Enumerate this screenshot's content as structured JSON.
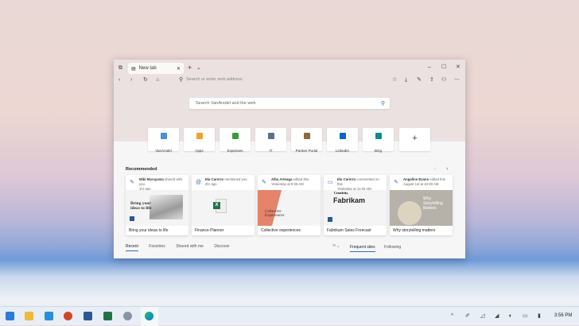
{
  "browser": {
    "tab_title": "New tab",
    "address_placeholder": "Search or enter web address",
    "search_placeholder": "Search VanArsdel and the web"
  },
  "quick_links": [
    {
      "label": "VanArsdel",
      "color": "#4a90d9"
    },
    {
      "label": "Apps",
      "color": "#f0a030"
    },
    {
      "label": "Expenses",
      "color": "#3a9a3a"
    },
    {
      "label": "IT",
      "color": "#5a7090"
    },
    {
      "label": "Partner Portal",
      "color": "#8a6a40"
    },
    {
      "label": "LinkedIn",
      "color": "#0a66c2"
    },
    {
      "label": "Bing",
      "color": "#0a8a8a"
    }
  ],
  "recommended": {
    "heading": "Recommended",
    "cards": [
      {
        "who": "Miki Maruyama",
        "action": "shared with you",
        "when": "1hr ago",
        "title": "Bring your ideas to life",
        "preview": "Bring your ideas to life"
      },
      {
        "who": "Ela Carerro",
        "action": "mentioned you",
        "when": "2hr ago",
        "title": "Finance Planner",
        "preview": "X"
      },
      {
        "who": "Alba Arteaga",
        "action": "edited this",
        "when": "Yesterday at 9:35 AM",
        "title": "Collective experiences",
        "preview": "Collective Experiences"
      },
      {
        "who": "Ela Carerro",
        "action": "commented on this",
        "when": "Yesterday at 11:03 AM",
        "title": "Fabrikam Sales Forecast",
        "preview": "Fabrikam",
        "preview2": "Creativity."
      },
      {
        "who": "Angeline Evans",
        "action": "edited this",
        "when": "August 1st at 10:20 AM",
        "title": "Why storytelling matters",
        "preview": "Why Storytelling Matters"
      }
    ]
  },
  "bottom_tabs": [
    "Recent",
    "Favorites",
    "Shared with me",
    "Discover"
  ],
  "right_tabs": [
    "Frequent sites",
    "Following"
  ],
  "taskbar": {
    "time": "3:56 PM"
  }
}
